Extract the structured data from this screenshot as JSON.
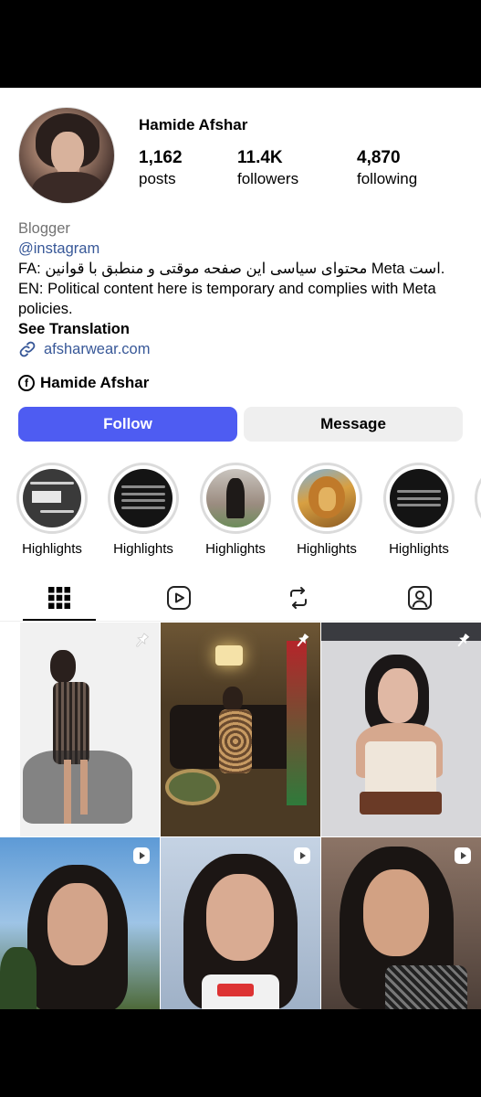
{
  "profile": {
    "username": "Hamide Afshar",
    "posts_count": "1,162",
    "posts_label": "posts",
    "followers_count": "11.4K",
    "followers_label": "followers",
    "following_count": "4,870",
    "following_label": "following"
  },
  "bio": {
    "category": "Blogger",
    "mention": "@instagram",
    "fa_line": "FA: محتوای سیاسی این صفحه موقتی و منطبق با قوانین Meta است.",
    "en_line": "EN: Political content here is temporary and complies with Meta policies.",
    "see_translation": "See Translation",
    "link": "afsharwear.com",
    "facebook_name": "Hamide Afshar"
  },
  "buttons": {
    "follow": "Follow",
    "message": "Message"
  },
  "highlights": [
    {
      "label": "Highlights"
    },
    {
      "label": "Highlights"
    },
    {
      "label": "Highlights"
    },
    {
      "label": "Highlights"
    },
    {
      "label": "Highlights"
    }
  ],
  "tabs": [
    {
      "name": "grid",
      "icon": "grid-icon",
      "active": true
    },
    {
      "name": "reels",
      "icon": "reels-icon",
      "active": false
    },
    {
      "name": "reposts",
      "icon": "repost-icon",
      "active": false
    },
    {
      "name": "tagged",
      "icon": "tagged-icon",
      "active": false
    }
  ],
  "colors": {
    "follow_button": "#4e5cf2",
    "link": "#385898",
    "secondary_button": "#efefef"
  }
}
